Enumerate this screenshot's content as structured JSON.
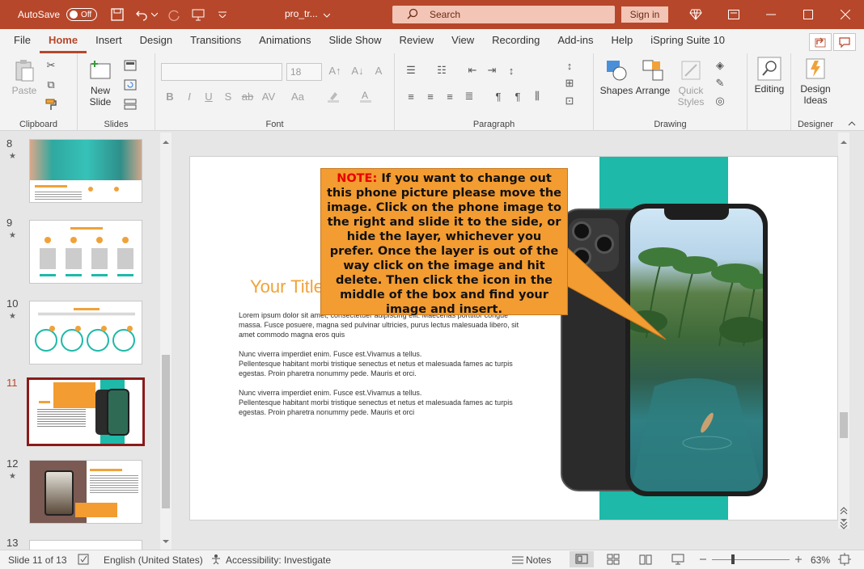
{
  "titlebar": {
    "autosave_label": "AutoSave",
    "autosave_state": "Off",
    "filename": "pro_tr...",
    "search_placeholder": "Search",
    "signin": "Sign in"
  },
  "menu": {
    "tabs": [
      "File",
      "Home",
      "Insert",
      "Design",
      "Transitions",
      "Animations",
      "Slide Show",
      "Review",
      "View",
      "Recording",
      "Add-ins",
      "Help",
      "iSpring Suite 10"
    ],
    "active": "Home"
  },
  "ribbon": {
    "clipboard": {
      "paste": "Paste",
      "label": "Clipboard"
    },
    "slides": {
      "new_slide": "New Slide",
      "label": "Slides"
    },
    "font": {
      "font_name": "",
      "font_size": "18",
      "label": "Font"
    },
    "paragraph": {
      "label": "Paragraph"
    },
    "drawing": {
      "shapes": "Shapes",
      "arrange": "Arrange",
      "quick_styles": "Quick Styles",
      "label": "Drawing"
    },
    "editing": {
      "label": "Editing"
    },
    "designer": {
      "design_ideas": "Design Ideas",
      "label": "Designer"
    }
  },
  "thumbnails": [
    {
      "num": "8"
    },
    {
      "num": "9"
    },
    {
      "num": "10"
    },
    {
      "num": "11",
      "active": true
    },
    {
      "num": "12"
    },
    {
      "num": "13"
    }
  ],
  "slide": {
    "title": "Your Title",
    "note_label": "NOTE:",
    "note_text": "If you want to change out this phone picture please move the image. Click on the phone image to the right and slide it to the side, or hide the layer, whichever you prefer. Once the layer is out of the way click on the image and hit delete. Then click the icon in the middle of the box and find your image and insert.",
    "body_p1": "Lorem ipsum dolor sit amet, consectetuer adipiscing elit. Maecenas porttitor congue massa. Fusce posuere, magna sed pulvinar ultricies, purus lectus malesuada libero, sit amet commodo magna eros quis",
    "body_p2a": "Nunc viverra imperdiet enim. Fusce est.Vivamus a tellus.",
    "body_p2b": "Pellentesque habitant morbi tristique senectus et netus et malesuada fames ac turpis egestas. Proin pharetra nonummy pede. Mauris et orci.",
    "body_p3a": "Nunc viverra imperdiet enim. Fusce est.Vivamus a tellus.",
    "body_p3b": "Pellentesque habitant morbi tristique senectus et netus et malesuada fames ac turpis egestas. Proin pharetra nonummy pede. Mauris et orci"
  },
  "statusbar": {
    "slide_info": "Slide 11 of 13",
    "language": "English (United States)",
    "accessibility": "Accessibility: Investigate",
    "notes": "Notes",
    "zoom": "63%"
  },
  "colors": {
    "accent": "#b7472a",
    "teal": "#1eb9a8",
    "note": "#f39c31"
  }
}
